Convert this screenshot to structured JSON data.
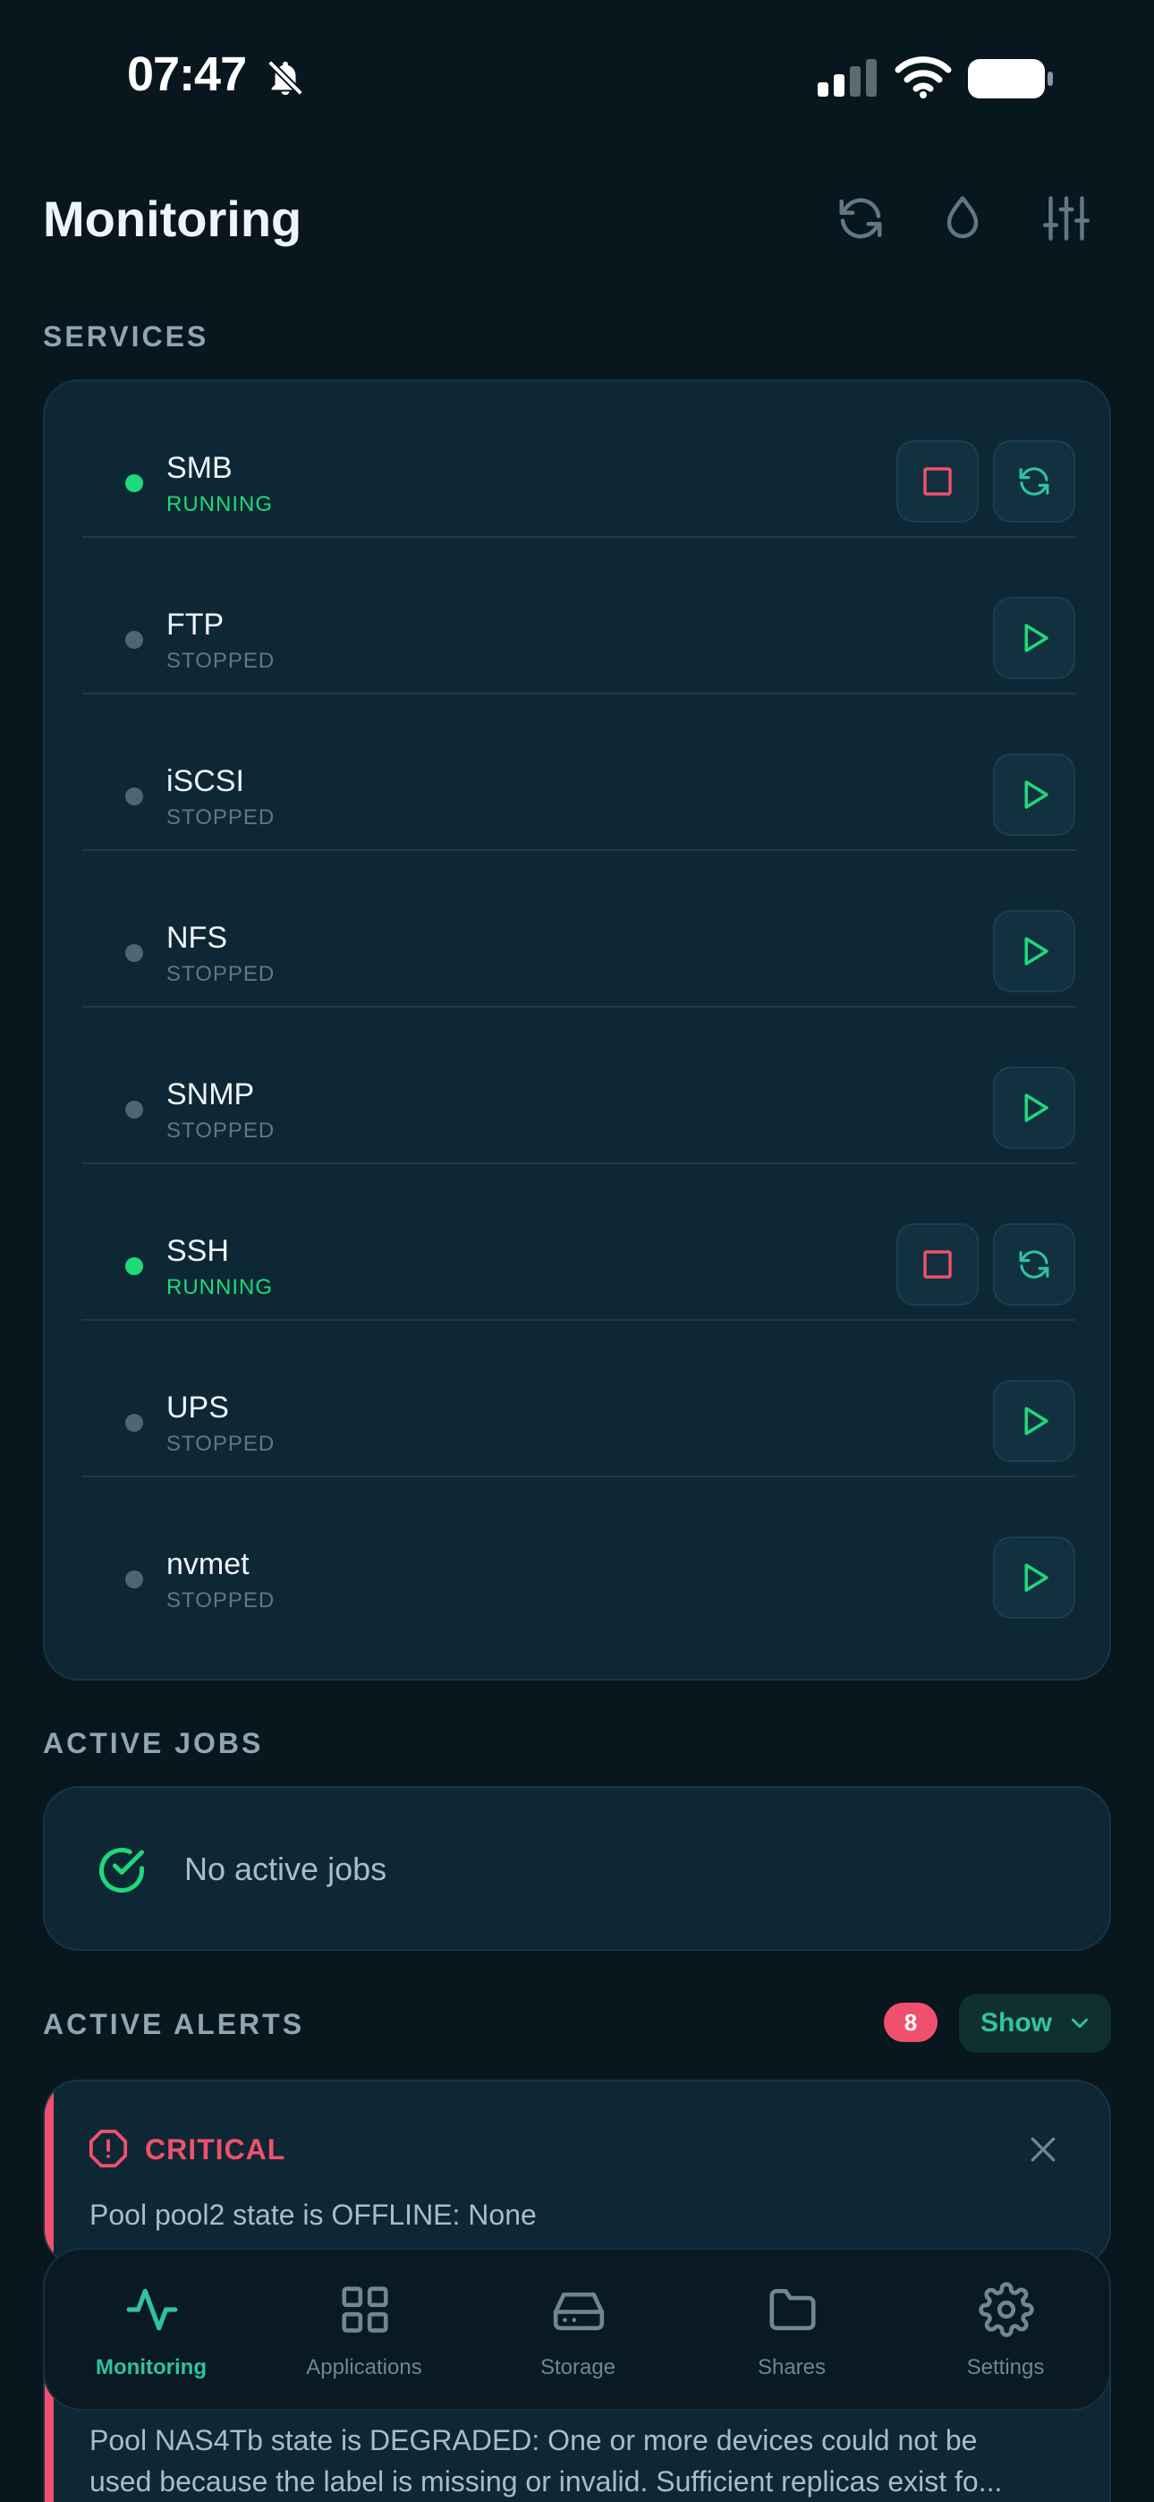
{
  "status_bar": {
    "time": "07:47"
  },
  "header": {
    "title": "Monitoring"
  },
  "services": {
    "label": "SERVICES",
    "items": [
      {
        "name": "SMB",
        "state": "RUNNING",
        "running": true
      },
      {
        "name": "FTP",
        "state": "STOPPED",
        "running": false
      },
      {
        "name": "iSCSI",
        "state": "STOPPED",
        "running": false
      },
      {
        "name": "NFS",
        "state": "STOPPED",
        "running": false
      },
      {
        "name": "SNMP",
        "state": "STOPPED",
        "running": false
      },
      {
        "name": "SSH",
        "state": "RUNNING",
        "running": true
      },
      {
        "name": "UPS",
        "state": "STOPPED",
        "running": false
      },
      {
        "name": "nvmet",
        "state": "STOPPED",
        "running": false
      }
    ]
  },
  "jobs": {
    "label": "ACTIVE JOBS",
    "empty_text": "No active jobs"
  },
  "alerts": {
    "label": "ACTIVE ALERTS",
    "count": "8",
    "show_label": "Show",
    "items": [
      {
        "level": "CRITICAL",
        "message": "Pool pool2 state is OFFLINE: None"
      },
      {
        "level": "",
        "message_line1": "Pool NAS4Tb state is DEGRADED: One or more devices could not be",
        "message_line2": "used because the label is missing or invalid. Sufficient replicas exist fo..."
      }
    ]
  },
  "nav": {
    "items": [
      {
        "label": "Monitoring",
        "icon": "activity-icon",
        "active": true
      },
      {
        "label": "Applications",
        "icon": "grid-icon",
        "active": false
      },
      {
        "label": "Storage",
        "icon": "hard-drive-icon",
        "active": false
      },
      {
        "label": "Shares",
        "icon": "folder-icon",
        "active": false
      },
      {
        "label": "Settings",
        "icon": "gear-icon",
        "active": false
      }
    ]
  },
  "colors": {
    "background": "#08161e",
    "card": "#0e2734",
    "running": "#1ed97a",
    "stopped": "#4d6672",
    "accent": "#2fc39e",
    "critical": "#f0506e"
  }
}
